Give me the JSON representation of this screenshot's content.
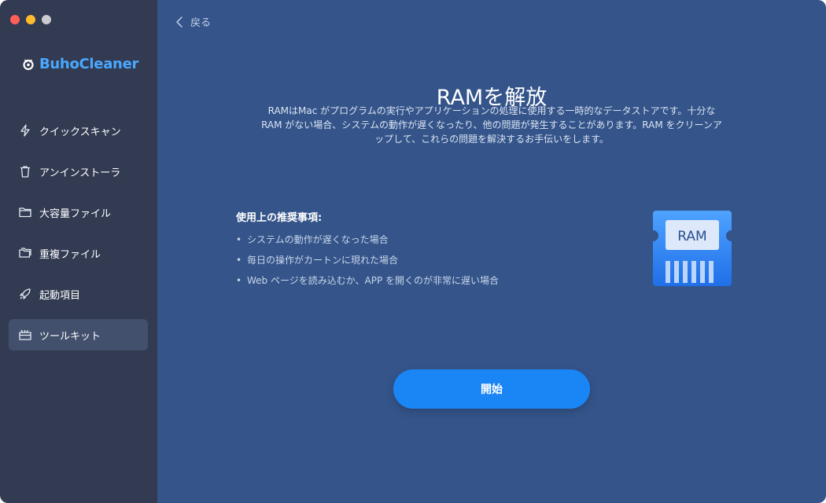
{
  "app": {
    "name": "BuhoCleaner",
    "brand_color": "#4aa8ff"
  },
  "window_controls": [
    "close",
    "minimize",
    "maximize"
  ],
  "sidebar": {
    "items": [
      {
        "label": "クイックスキャン",
        "icon": "lightning-icon",
        "active": false
      },
      {
        "label": "アンインストーラ",
        "icon": "trash-icon",
        "active": false
      },
      {
        "label": "大容量ファイル",
        "icon": "folder-icon",
        "active": false
      },
      {
        "label": "重複ファイル",
        "icon": "duplicate-folder-icon",
        "active": false
      },
      {
        "label": "起動項目",
        "icon": "rocket-icon",
        "active": false
      },
      {
        "label": "ツールキット",
        "icon": "toolkit-icon",
        "active": true
      }
    ]
  },
  "header": {
    "back_label": "戻る"
  },
  "main": {
    "title": "RAMを解放",
    "description_lines": [
      "RAMはMac がプログラムの実行やアプリケーションの処理に使用する一時的なデータストアです。十分な",
      "RAM がない場合、システムの動作が遅くなったり、他の問題が発生することがあります。RAM をクリーンア",
      "ップして、これらの問題を解決するお手伝いをします。"
    ],
    "recommendations_title": "使用上の推奨事項:",
    "recommendations": [
      "システムの動作が遅くなった場合",
      "毎日の操作がカートンに現れた場合",
      "Web ページを読み込むか、APP を開くのが非常に遅い場合"
    ],
    "illustration_label": "RAM",
    "start_button_label": "開始"
  },
  "colors": {
    "sidebar_bg": "#323b52",
    "main_bg": "#34548a",
    "accent": "#1a85f5"
  }
}
